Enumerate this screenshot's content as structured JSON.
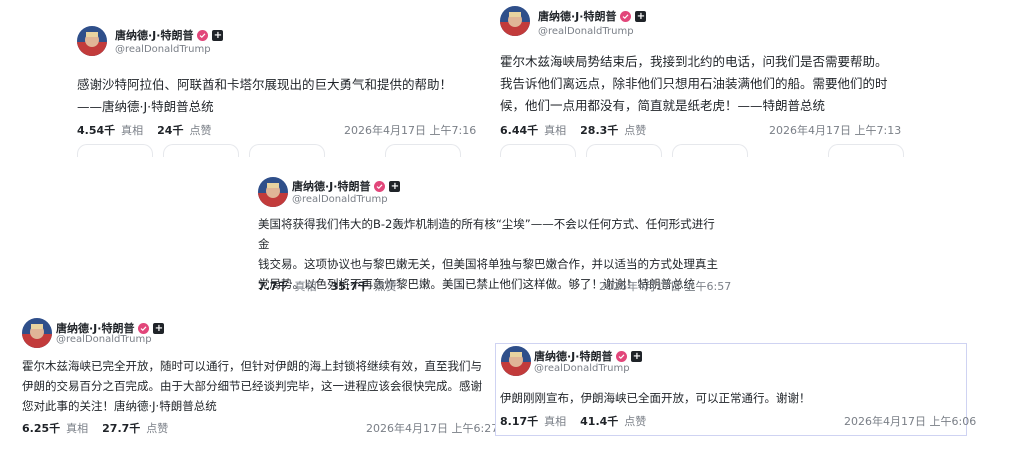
{
  "posts": [
    {
      "author": "唐纳德·J·特朗普",
      "handle": "@realDonaldTrump",
      "text_lines": [
        "感谢沙特阿拉伯、阿联酋和卡塔尔展现出的巨大勇气和提供的帮助！",
        "——唐纳德·J·特朗普总统"
      ],
      "reposts": "4.54千",
      "reposts_label": "真相",
      "likes": "24千",
      "likes_label": "点赞",
      "timestamp": "2026年4月17日 上午7:16"
    },
    {
      "author": "唐纳德·J·特朗普",
      "handle": "@realDonaldTrump",
      "text_lines": [
        "霍尔木兹海峡局势结束后，我接到北约的电话，问我们是否需要帮助。",
        "我告诉他们离远点，除非他们只想用石油装满他们的船。需要他们的时",
        "候，他们一点用都没有，简直就是纸老虎！——特朗普总统"
      ],
      "reposts": "6.44千",
      "reposts_label": "真相",
      "likes": "28.3千",
      "likes_label": "点赞",
      "timestamp": "2026年4月17日 上午7:13"
    },
    {
      "author": "唐纳德·J·特朗普",
      "handle": "@realDonaldTrump",
      "text_lines": [
        "美国将获得我们伟大的B-2轰炸机制造的所有核“尘埃”——不会以任何方式、任何形式进行金",
        "钱交易。这项协议也与黎巴嫩无关，但美国将单独与黎巴嫩合作，并以适当的方式处理真主",
        "党局势。以色列将不再轰炸黎巴嫩。美国已禁止他们这样做。够了！谢谢！特朗普总统"
      ],
      "reposts": "7.7千",
      "reposts_label": "真相",
      "likes": "35.7千",
      "likes_label": "点赞",
      "timestamp": "2026年4月17日 上午6:57"
    },
    {
      "author": "唐纳德·J·特朗普",
      "handle": "@realDonaldTrump",
      "text_lines": [
        "霍尔木兹海峡已完全开放，随时可以通行，但针对伊朗的海上封锁将继续有效，直至我们与",
        "伊朗的交易百分之百完成。由于大部分细节已经谈判完毕，这一进程应该会很快完成。感谢",
        "您对此事的关注！唐纳德·J·特朗普总统"
      ],
      "reposts": "6.25千",
      "reposts_label": "真相",
      "likes": "27.7千",
      "likes_label": "点赞",
      "timestamp": "2026年4月17日 上午6:27"
    },
    {
      "author": "唐纳德·J·特朗普",
      "handle": "@realDonaldTrump",
      "text_lines": [
        "伊朗刚刚宣布，伊朗海峡已全面开放，可以正常通行。谢谢！"
      ],
      "reposts": "8.17千",
      "reposts_label": "真相",
      "likes": "41.4千",
      "likes_label": "点赞",
      "timestamp": "2026年4月17日 上午6:06"
    }
  ],
  "colors": {
    "verified": "#e2467a",
    "muted": "#7a7f87",
    "frame": "#cfd3f2"
  }
}
